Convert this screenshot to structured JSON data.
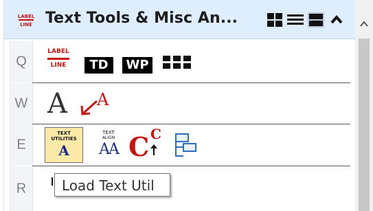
{
  "panel": {
    "title": "Text Tools & Misc An...",
    "title_icon": "label-line-icon",
    "toolbar": [
      {
        "name": "grid-view-icon"
      },
      {
        "name": "list-view-icon"
      },
      {
        "name": "large-view-icon"
      },
      {
        "name": "collapse-chevron-icon"
      }
    ]
  },
  "rows": [
    {
      "key": "Q"
    },
    {
      "key": "W"
    },
    {
      "key": "E"
    },
    {
      "key": "R"
    }
  ],
  "tools": {
    "label_line": {
      "top": "LABEL",
      "bottom": "LINE"
    },
    "td_label": "TD",
    "wp_label": "WP",
    "place_text": "A",
    "leader_text": "A",
    "text_utilities": {
      "line1": "TEXT",
      "line2": "UTILITIES",
      "letter": "A"
    },
    "text_align": {
      "line1": "TEXT",
      "line2": "ALIGN",
      "letters": "AA"
    },
    "change_case": {
      "big": "C",
      "small": "C"
    }
  },
  "tooltip": {
    "text": "Load Text Util"
  },
  "colors": {
    "accent_red": "#cc1111",
    "title_bg": "#dfeeff",
    "highlight": "#fde9a8"
  }
}
